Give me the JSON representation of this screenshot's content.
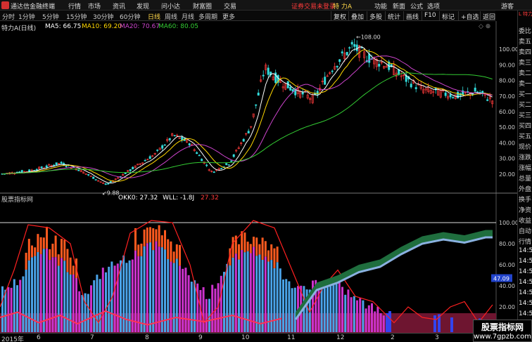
{
  "app": {
    "title": "通达信金融终端",
    "menu": [
      "行情",
      "市场",
      "资讯",
      "发现",
      "问小达",
      "财富圈",
      "交易"
    ],
    "promo": "证券交易未登录",
    "stock_badge": "特 力A",
    "right_menu": [
      "功能",
      "新面",
      "公式",
      "选项",
      "游客"
    ]
  },
  "toolbar": {
    "timeframes": [
      "分时",
      "1分钟",
      "5分钟",
      "15分钟",
      "30分钟",
      "60分钟",
      "日线",
      "周线",
      "月线",
      "多周期",
      "更多"
    ],
    "active_timeframe": "日线",
    "buttons": [
      "复权",
      "叠加",
      "多股",
      "统计",
      "画线",
      "F10",
      "标记",
      "+自选",
      "返回"
    ]
  },
  "legend": {
    "stock": "特力A(日线)",
    "ma5": "MA5: 66.75",
    "ma10": "MA10: 69.20",
    "ma20": "MA20: 70.67",
    "ma60": "MA60: 80.05"
  },
  "price_axis": {
    "labels": [
      "100.00",
      "90.00",
      "80.00",
      "70.00",
      "60.00",
      "50.00",
      "40.00",
      "30.00",
      "20.00"
    ],
    "high_label": "108.00",
    "low_label": "9.88"
  },
  "indicator": {
    "title": "股票指标网",
    "okk": "OKK0: 27.32",
    "wll": "WLL: -1.8J",
    "extra": "27.32",
    "axis_labels": [
      "100.00",
      "80.00",
      "60.00",
      "40.00",
      "20.00"
    ],
    "marker": "47.09"
  },
  "xaxis": {
    "labels": [
      "2015年",
      "6",
      "7",
      "8",
      "9",
      "10",
      "11",
      "12",
      "2",
      "3"
    ]
  },
  "right_panel": {
    "header": "L 特力A",
    "items": [
      "委比",
      "卖五",
      "卖四",
      "卖三",
      "卖二",
      "卖一",
      "买一",
      "买二",
      "买三",
      "买四",
      "买五",
      "现价",
      "涨跌",
      "涨幅",
      "总量",
      "外盘",
      "换手",
      "净资",
      "收益",
      "自动",
      "行情",
      "14:5",
      "14:5",
      "14:5",
      "14:5",
      "14:5",
      "14:5",
      "14:5",
      "14:5",
      "14:5"
    ]
  },
  "watermark": {
    "line1": "股票指标网",
    "line2": "www.7gpzb.com"
  },
  "colors": {
    "ma5": "#ffffff",
    "ma10": "#ffd700",
    "ma20": "#cc44cc",
    "ma60": "#33cc33",
    "up": "#ff3b3b",
    "down": "#33dddd",
    "bar_blue": "#4aa3e8",
    "bar_purple": "#cc33cc",
    "bar_orange": "#ff5a1f",
    "band_bg": "#6e1530",
    "band_green": "#1f6e3e",
    "band_lightblue": "#8ab0e0",
    "red_line": "#ff2020"
  }
}
